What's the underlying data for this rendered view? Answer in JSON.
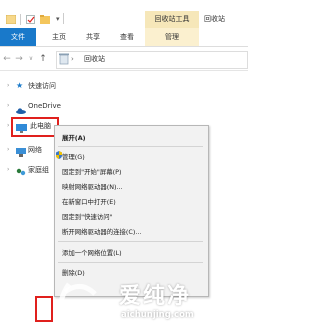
{
  "titlebar": {
    "context_tab": "回收站工具",
    "window_title": "回收站"
  },
  "ribbon": {
    "tabs": [
      "文件",
      "主页",
      "共享",
      "查看",
      "管理"
    ]
  },
  "address": {
    "path": "回收站",
    "separator": "›"
  },
  "sidebar": {
    "items": [
      {
        "label": "快速访问",
        "icon": "star-icon"
      },
      {
        "label": "OneDrive",
        "icon": "cloud-icon"
      },
      {
        "label": "此电脑",
        "icon": "computer-icon"
      },
      {
        "label": "网络",
        "icon": "network-icon"
      },
      {
        "label": "家庭组",
        "icon": "homegroup-icon"
      }
    ]
  },
  "context_menu": {
    "items": [
      "展开(A)",
      "管理(G)",
      "固定到\"开始\"屏幕(P)",
      "映射网络驱动器(N)...",
      "在新窗口中打开(E)",
      "固定到\"快速访问\"",
      "断开网络驱动器的连接(C)...",
      "添加一个网络位置(L)",
      "删除(D)"
    ]
  },
  "watermark": {
    "title": "爱纯净",
    "url": "aichunjing.com"
  },
  "colors": {
    "file_tab": "#1979ca",
    "context_tab": "#f6e7b9",
    "highlight": "#e0201d"
  }
}
